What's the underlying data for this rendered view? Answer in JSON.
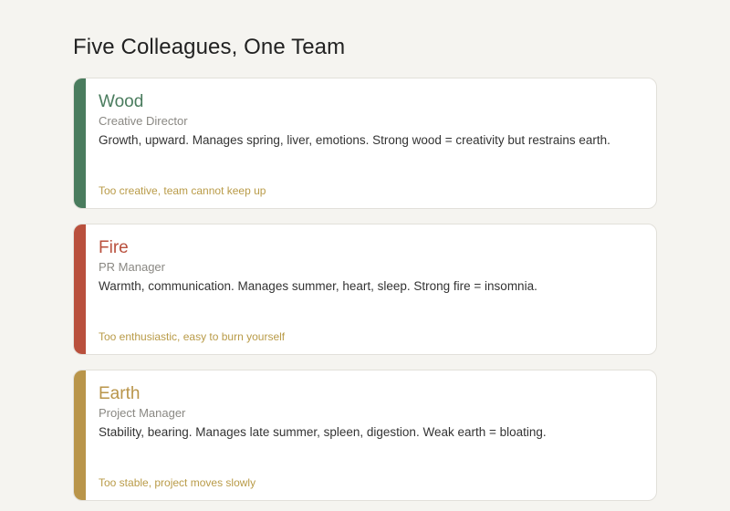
{
  "page": {
    "title": "Five Colleagues, One Team"
  },
  "cards": [
    {
      "name": "Wood",
      "role": "Creative Director",
      "description": "Growth, upward. Manages spring, liver, emotions. Strong wood = creativity but restrains earth.",
      "warning": "Too creative, team cannot keep up",
      "color": "#4a7c5e"
    },
    {
      "name": "Fire",
      "role": "PR Manager",
      "description": "Warmth, communication. Manages summer, heart, sleep. Strong fire = insomnia.",
      "warning": "Too enthusiastic, easy to burn yourself",
      "color": "#b9503d"
    },
    {
      "name": "Earth",
      "role": "Project Manager",
      "description": "Stability, bearing. Manages late summer, spleen, digestion. Weak earth = bloating.",
      "warning": "Too stable, project moves slowly",
      "color": "#b9954a"
    }
  ],
  "colors": {
    "background": "#f5f4f0",
    "warning_text": "#b99b48",
    "card_border": "#e2e0da"
  }
}
